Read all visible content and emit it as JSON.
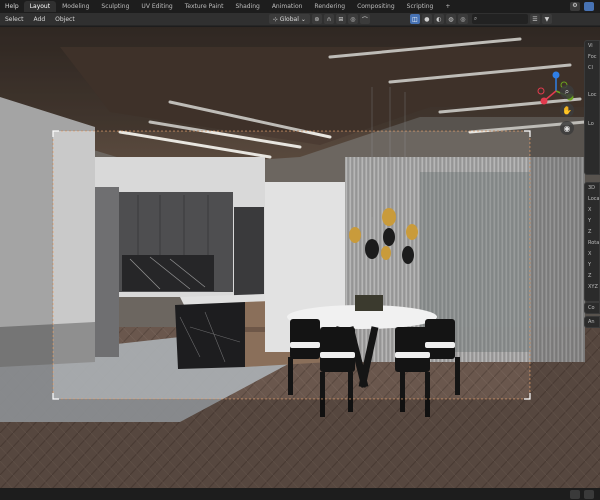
{
  "topbar": {
    "menu_help": "Help",
    "tabs": [
      "Layout",
      "Modeling",
      "Sculpting",
      "UV Editing",
      "Texture Paint",
      "Shading",
      "Animation",
      "Rendering",
      "Compositing",
      "Scripting"
    ],
    "active_tab": "Layout",
    "add_tab": "+"
  },
  "header": {
    "menus": [
      "Select",
      "Add",
      "Object"
    ],
    "orientation_label": "Global",
    "orientation_arrow": "⌄",
    "search_placeholder": ""
  },
  "npanel": {
    "view_tab_top": "Vi",
    "view_rows": [
      "Foc",
      "Cl"
    ],
    "loc_label": "Loc",
    "lo_label": "Lo",
    "group_3d": "3D",
    "location": "Loca",
    "x": "X",
    "y": "Y",
    "z": "Z",
    "rotation": "Rota",
    "xyz": "XYZ",
    "co_label": "Co",
    "an_label": "An"
  },
  "colors": {
    "accent": "#4772b3",
    "gizmo_x": "#e23b4e",
    "gizmo_y": "#6ba51f",
    "gizmo_z": "#2f7fe6",
    "camera_frame": "#e8a470"
  }
}
